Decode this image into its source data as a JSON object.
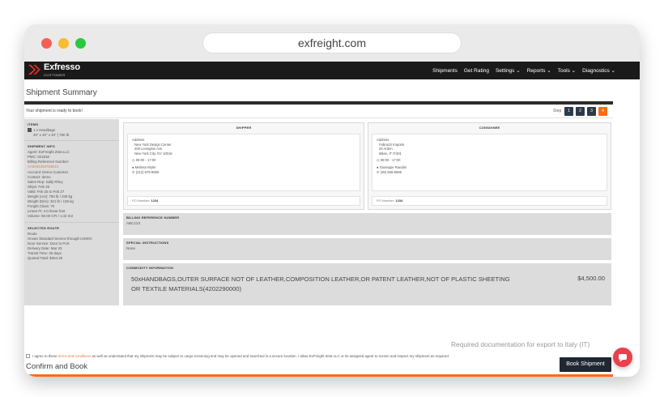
{
  "browser": {
    "url": "exfreight.com"
  },
  "navbar": {
    "brand": "Exfresso",
    "brand_sub": "CUSTOMER",
    "items": [
      "Shipments",
      "Get Rating",
      "Settings ⌄",
      "Reports ⌄",
      "Tools ⌄",
      "Diagnostics ⌄"
    ]
  },
  "page_title": "Shipment Summary",
  "ready_message": "Your shipment is ready to book!",
  "steps": {
    "label": "Step",
    "items": [
      "1",
      "2",
      "3",
      "4"
    ],
    "active_index": 3
  },
  "left_panel": {
    "items": {
      "heading": "ITEMS",
      "line1": "1 x Handbags",
      "line2": "40\" x 40\" x 40\" | 750 lb"
    },
    "shipment_info": {
      "heading": "SHIPMENT INFO",
      "lines": [
        "Agent: ExFreight Zeta LLC",
        "PMC: 021818",
        "Billing Reference Number:",
        "AA0044253754D10",
        "Account: Demo Customer",
        "Contact: demo",
        "Sales Rep: Sally Rhey",
        "Ships: Feb 26",
        "Valid: Feb 25 to Feb 27",
        "Weight (Act): 750 lb / 340 kg",
        "Weight (Dim): 321 lb / 136 kg",
        "Freight Class: 70",
        "Linear Ft: 4.0 linear feet",
        "Volume: 50.00 CFt / 1.42 m3"
      ]
    },
    "selected_route": {
      "heading": "SELECTED ROUTE",
      "lines": [
        "Route",
        "Ocean Standard Service through USWIC",
        "Door Service: Door to Port",
        "Delivery Date: Mar 23",
        "Transit Time: 26 days",
        "Quoted Total: $454.25"
      ]
    }
  },
  "shipper": {
    "heading": "SHIPPER",
    "address_label": "Address",
    "address_lines": [
      "New York Design Center",
      "200 Lexington Ave",
      "New York City, NY 10016"
    ],
    "hours": "08:00 - 17:00",
    "contact": "Melissa Wyler",
    "phone": "(212) 679-9500",
    "po_label": "PO Number:",
    "po_value": "1234"
  },
  "consignee": {
    "heading": "CONSIGNEE",
    "address_label": "Address",
    "address_lines": [
      "Fabrazzi Imports",
      "26 Arden",
      "Milan, IT IT401"
    ],
    "hours": "08:00 - 17:00",
    "contact": "Giuseppe Randini",
    "phone": "(26) 555-5555",
    "po_label": "PO Number:",
    "po_value": "1234"
  },
  "billing_reference": {
    "heading": "BILLING REFERENCE NUMBER",
    "value": "ABC123"
  },
  "special_instructions": {
    "heading": "SPECIAL INSTRUCTIONS",
    "value": "None"
  },
  "commodity": {
    "heading": "COMMODITY INFORMATION",
    "description": "50xHANDBAGS,OUTER SURFACE NOT OF LEATHER,COMPOSITION LEATHER,OR PATENT LEATHER,NOT OF PLASTIC SHEETING OR TEXTILE MATERIALS(4202290000)",
    "price": "$4,500.00"
  },
  "required_docs": "Required documentation for export to Italy (IT)",
  "confirm": {
    "title": "Confirm and Book",
    "agreement_prefix": "I agree to these ",
    "agreement_link": "terms and conditions",
    "agreement_suffix": " as well as understand that my shipment may be subject to cargo screening and may be opened and searched in a secure location. I allow ExFreight Zeta LLC or its assigned agent to screen and inspect my shipment as required.",
    "book_button": "Book Shipment"
  },
  "colors": {
    "accent": "#ff6a18",
    "nav_bg": "#1a1a1a",
    "chat": "#e8404d"
  }
}
